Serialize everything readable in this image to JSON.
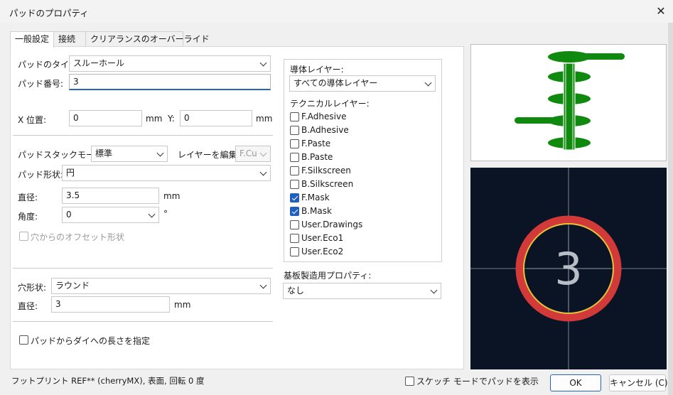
{
  "window": {
    "title": "パッドのプロパティ"
  },
  "tabs": [
    {
      "label": "一般設定",
      "active": true
    },
    {
      "label": "接続",
      "active": false
    },
    {
      "label": "クリアランスのオーバーライド",
      "active": false
    }
  ],
  "pad": {
    "type_label": "パッドのタイプ:",
    "type_value": "スルーホール",
    "number_label": "パッド番号:",
    "number_value": "3",
    "x_label": "X 位置:",
    "x_value": "0",
    "x_unit": "mm",
    "y_label": "Y:",
    "y_value": "0",
    "y_unit": "mm"
  },
  "stack": {
    "mode_label": "パッドスタックモード:",
    "mode_value": "標準",
    "edit_layer_label": "レイヤーを編集:",
    "edit_layer_value": "F.Cu",
    "shape_label": "パッド形状:",
    "shape_value": "円",
    "diameter_label": "直径:",
    "diameter_value": "3.5",
    "diameter_unit": "mm",
    "angle_label": "角度:",
    "angle_value": "0",
    "angle_unit": "°",
    "offset_label": "穴からのオフセット形状"
  },
  "hole": {
    "shape_label": "穴形状:",
    "shape_value": "ラウンド",
    "diameter_label": "直径:",
    "diameter_value": "3",
    "diameter_unit": "mm"
  },
  "die_length_label": "パッドからダイへの長さを指定",
  "layers": {
    "copper_label": "導体レイヤー:",
    "copper_value": "すべての導体レイヤー",
    "tech_label": "テクニカルレイヤー:",
    "items": [
      {
        "label": "F.Adhesive",
        "checked": false
      },
      {
        "label": "B.Adhesive",
        "checked": false
      },
      {
        "label": "F.Paste",
        "checked": false
      },
      {
        "label": "B.Paste",
        "checked": false
      },
      {
        "label": "F.Silkscreen",
        "checked": false
      },
      {
        "label": "B.Silkscreen",
        "checked": false
      },
      {
        "label": "F.Mask",
        "checked": true
      },
      {
        "label": "B.Mask",
        "checked": true
      },
      {
        "label": "User.Drawings",
        "checked": false
      },
      {
        "label": "User.Eco1",
        "checked": false
      },
      {
        "label": "User.Eco2",
        "checked": false
      }
    ]
  },
  "fab": {
    "label": "基板製造用プロパティ:",
    "value": "なし"
  },
  "preview": {
    "pad_number": "3",
    "colors": {
      "background": "#0b1424",
      "pad_ring": "#d23a3a",
      "pad_outline": "#e2c43a",
      "stack_green": "#0f8a0f",
      "crosshair": "#9aa3ad"
    }
  },
  "footer": {
    "info": "フットプリント REF** (cherryMX), 表面, 回転 0 度",
    "sketch_label": "スケッチ モードでパッドを表示",
    "ok_label": "OK",
    "cancel_label": "キャンセル (C)"
  }
}
